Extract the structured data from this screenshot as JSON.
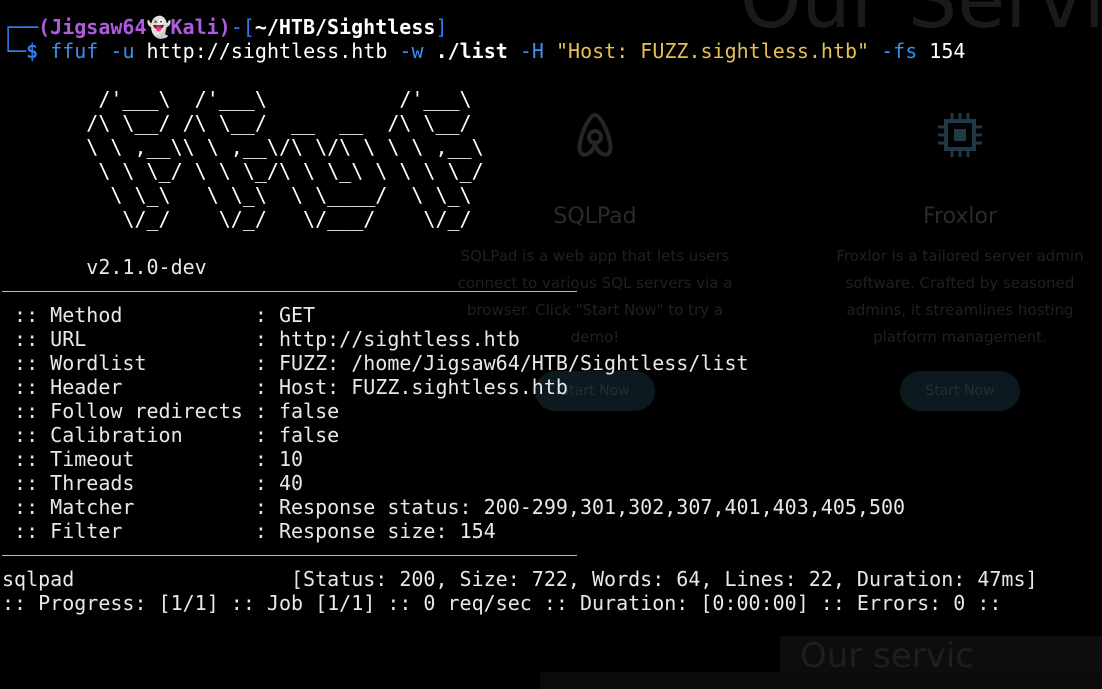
{
  "prompt": {
    "corner_top": "┌──",
    "corner_bottom": "└─",
    "user_host": "(Jigsaw64",
    "ghost": "👻",
    "user_host_tail": "Kali)",
    "dash": "-[",
    "cwd": "~/HTB/Sightless",
    "close": "]",
    "dollar": "$"
  },
  "command": {
    "program": "ffuf",
    "u_flag": "-u",
    "url": "http://sightless.htb",
    "w_flag": "-w",
    "wordlist": "./list",
    "h_flag": "-H",
    "header": "\"Host: FUZZ.sightless.htb\"",
    "fs_flag": "-fs",
    "fs_value": "154"
  },
  "banner": [
    "        /'___\\  /'___\\           /'___\\",
    "       /\\ \\__/ /\\ \\__/  __  __  /\\ \\__/",
    "       \\ \\ ,__\\\\ \\ ,__\\/\\ \\/\\ \\ \\ \\ ,__\\",
    "        \\ \\ \\_/ \\ \\ \\_/\\ \\ \\_\\ \\ \\ \\ \\_/",
    "         \\ \\_\\   \\ \\_\\  \\ \\____/  \\ \\_\\",
    "          \\/_/    \\/_/   \\/___/    \\/_/"
  ],
  "version": "       v2.1.0-dev",
  "config": [
    " :: Method           : GET",
    " :: URL              : http://sightless.htb",
    " :: Wordlist         : FUZZ: /home/Jigsaw64/HTB/Sightless/list",
    " :: Header           : Host: FUZZ.sightless.htb",
    " :: Follow redirects : false",
    " :: Calibration      : false",
    " :: Timeout          : 10",
    " :: Threads          : 40",
    " :: Matcher          : Response status: 200-299,301,302,307,401,403,405,500",
    " :: Filter           : Response size: 154"
  ],
  "result": "sqlpad                  [Status: 200, Size: 722, Words: 64, Lines: 22, Duration: 47ms]",
  "progress": ":: Progress: [1/1] :: Job [1/1] :: 0 req/sec :: Duration: [0:00:00] :: Errors: 0 ::",
  "background": {
    "heading": "Our Servic",
    "cards": [
      {
        "title": "SQLPad",
        "text": "SQLPad is a web app that lets users connect to various SQL servers via a browser. Click \"Start Now\" to try a demo!",
        "button": "Start Now"
      },
      {
        "title": "Froxlor",
        "text": "Froxlor is a tailored server admin software. Crafted by seasoned admins, it streamlines hosting platform management.",
        "button": "Start Now"
      }
    ],
    "bottom_text": "Our servic"
  },
  "colors": {
    "background": "#000000",
    "prompt_blue": "#2e7de9",
    "user_purple": "#b05be0",
    "string_yellow": "#e6c050",
    "text": "#e8e8e8"
  }
}
